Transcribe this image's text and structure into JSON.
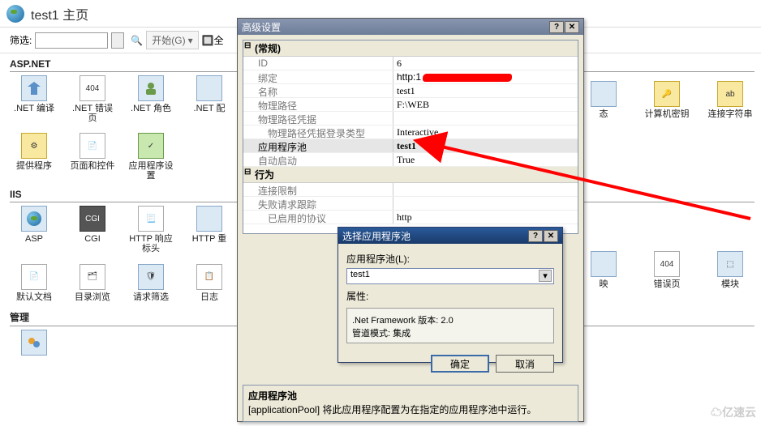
{
  "header": {
    "title": "test1 主页"
  },
  "filter": {
    "label": "筛选:",
    "start": "开始(G)",
    "showall": "全"
  },
  "sections": {
    "aspnet": {
      "title": "ASP.NET",
      "items": [
        ".NET 编译",
        ".NET 错误页",
        ".NET 角色",
        ".NET 配",
        "提供程序",
        "页面和控件",
        "应用程序设置"
      ]
    },
    "iis": {
      "title": "IIS",
      "items": [
        "ASP",
        "CGI",
        "HTTP 响应标头",
        "HTTP 重",
        "默认文档",
        "目录浏览",
        "请求筛选",
        "日志"
      ]
    },
    "mgmt": {
      "title": "管理"
    },
    "right": {
      "items": [
        "态",
        "计算机密钥",
        "连接字符串",
        "映",
        "错误页",
        "模块"
      ]
    }
  },
  "advDlg": {
    "title": "高级设置",
    "cat1": "(常规)",
    "rows": {
      "id": {
        "k": "ID",
        "v": "6"
      },
      "bind": {
        "k": "绑定",
        "v": "http:1"
      },
      "name": {
        "k": "名称",
        "v": "test1"
      },
      "path": {
        "k": "物理路径",
        "v": "F:\\WEB"
      },
      "cred": {
        "k": "物理路径凭据",
        "v": ""
      },
      "logon": {
        "k": "物理路径凭据登录类型",
        "v": "Interactive"
      },
      "pool": {
        "k": "应用程序池",
        "v": "test1"
      },
      "auto": {
        "k": "自动启动",
        "v": "True"
      }
    },
    "cat2": "行为",
    "rows2": {
      "connlim": {
        "k": "连接限制",
        "v": ""
      },
      "failreq": {
        "k": "失败请求跟踪",
        "v": ""
      },
      "proto": {
        "k": "已启用的协议",
        "v": "http"
      }
    },
    "desc": {
      "title": "应用程序池",
      "text": "[applicationPool] 将此应用程序配置为在指定的应用程序池中运行。"
    }
  },
  "poolDlg": {
    "title": "选择应用程序池",
    "label": "应用程序池(L):",
    "value": "test1",
    "propLabel": "属性:",
    "fw": ".Net Framework 版本: 2.0",
    "mode": "管道模式: 集成",
    "ok": "确定",
    "cancel": "取消"
  },
  "watermark": "亿速云"
}
